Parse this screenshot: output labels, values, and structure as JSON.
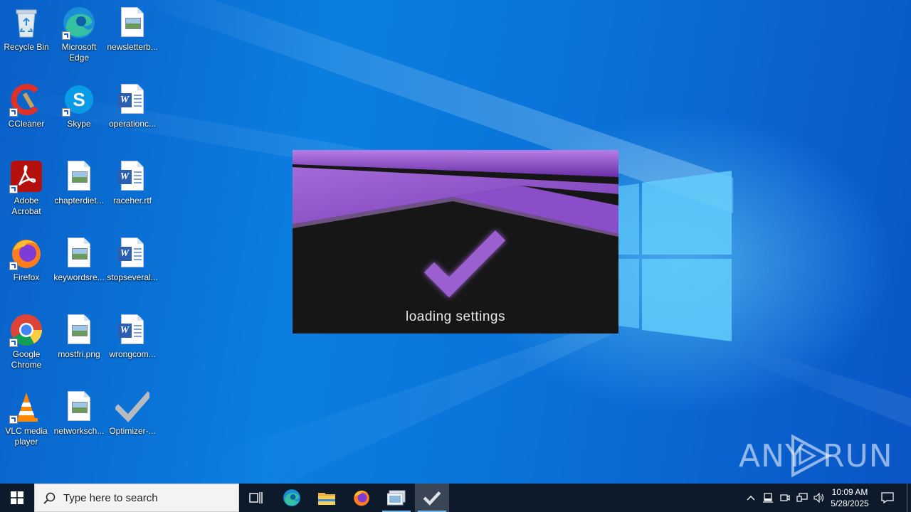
{
  "desktop_icons": [
    {
      "label": "Recycle Bin"
    },
    {
      "label": "Microsoft Edge"
    },
    {
      "label": "newsletterb..."
    },
    {
      "label": "CCleaner"
    },
    {
      "label": "Skype"
    },
    {
      "label": "operationc..."
    },
    {
      "label": "Adobe Acrobat"
    },
    {
      "label": "chapterdiet..."
    },
    {
      "label": "raceher.rtf"
    },
    {
      "label": "Firefox"
    },
    {
      "label": "keywordsre..."
    },
    {
      "label": "stopseveral..."
    },
    {
      "label": "Google Chrome"
    },
    {
      "label": "mostfri.png"
    },
    {
      "label": "wrongcom..."
    },
    {
      "label": "VLC media player"
    },
    {
      "label": "networksch..."
    },
    {
      "label": "Optimizer-..."
    }
  ],
  "splash": {
    "status_text": "loading settings",
    "accent_color": "#9b5fd0"
  },
  "watermark": {
    "text_left": "ANY",
    "text_right": "RUN"
  },
  "taskbar": {
    "search_placeholder": "Type here to search",
    "clock_time": "10:09 AM",
    "clock_date": "5/28/2025"
  },
  "colors": {
    "desktop_bg": "#0a7ad8",
    "taskbar_bg": "#0d1a2b"
  }
}
